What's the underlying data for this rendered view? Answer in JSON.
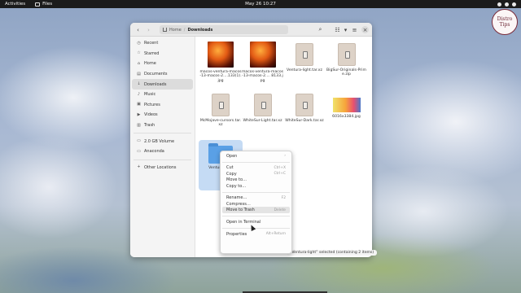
{
  "topbar": {
    "activities": "Activities",
    "app_name": "Files",
    "clock": "May 26  10:27"
  },
  "logo": {
    "line1": "Distro",
    "line2": "Tips"
  },
  "window": {
    "path": {
      "home": "Home",
      "current": "Downloads"
    }
  },
  "sidebar": {
    "items": [
      {
        "label": "Recent",
        "icon": "clock-icon"
      },
      {
        "label": "Starred",
        "icon": "star-icon"
      },
      {
        "label": "Home",
        "icon": "home-icon"
      },
      {
        "label": "Documents",
        "icon": "document-icon"
      },
      {
        "label": "Downloads",
        "icon": "download-icon"
      },
      {
        "label": "Music",
        "icon": "music-icon"
      },
      {
        "label": "Pictures",
        "icon": "picture-icon"
      },
      {
        "label": "Videos",
        "icon": "video-icon"
      },
      {
        "label": "Trash",
        "icon": "trash-icon"
      }
    ],
    "devices": [
      {
        "label": "2.0 GB Volume",
        "icon": "drive-icon"
      },
      {
        "label": "Anaconda",
        "icon": "drive-icon"
      }
    ],
    "other": {
      "label": "Other Locations",
      "icon": "plus-icon"
    }
  },
  "files": [
    {
      "name": "macos-ventura-macos-13-macos-2....133(1).jpg",
      "kind": "img-ventura"
    },
    {
      "name": "macos-ventura-macos-13-macos-2.... 8133.jpg",
      "kind": "img-ventura"
    },
    {
      "name": "Ventura-light.tar.xz",
      "kind": "archive"
    },
    {
      "name": "BigSur-Originals-Prime.zip",
      "kind": "archive"
    },
    {
      "name": "McMojave-cursors.tar.xz",
      "kind": "archive"
    },
    {
      "name": "WhiteSur-Light.tar.xz",
      "kind": "archive"
    },
    {
      "name": "WhiteSur-Dark.tar.xz",
      "kind": "archive"
    },
    {
      "name": "6016x3384.jpg",
      "kind": "img-wide"
    },
    {
      "name": "Ventura-light",
      "kind": "folder"
    }
  ],
  "status": "“Ventura-light” selected (containing 2 items)",
  "context_menu": {
    "groups": [
      [
        {
          "label": "Open",
          "accel": "›"
        }
      ],
      [
        {
          "label": "Cut",
          "accel": "Ctrl+X"
        },
        {
          "label": "Copy",
          "accel": "Ctrl+C"
        },
        {
          "label": "Move to…",
          "accel": ""
        },
        {
          "label": "Copy to…",
          "accel": ""
        }
      ],
      [
        {
          "label": "Rename…",
          "accel": "F2"
        },
        {
          "label": "Compress…",
          "accel": ""
        },
        {
          "label": "Move to Trash",
          "accel": "Delete"
        }
      ],
      [
        {
          "label": "Open in Terminal",
          "accel": ""
        }
      ],
      [
        {
          "label": "Properties",
          "accel": "Alt+Return"
        }
      ]
    ],
    "hovered": "Move to Trash"
  }
}
